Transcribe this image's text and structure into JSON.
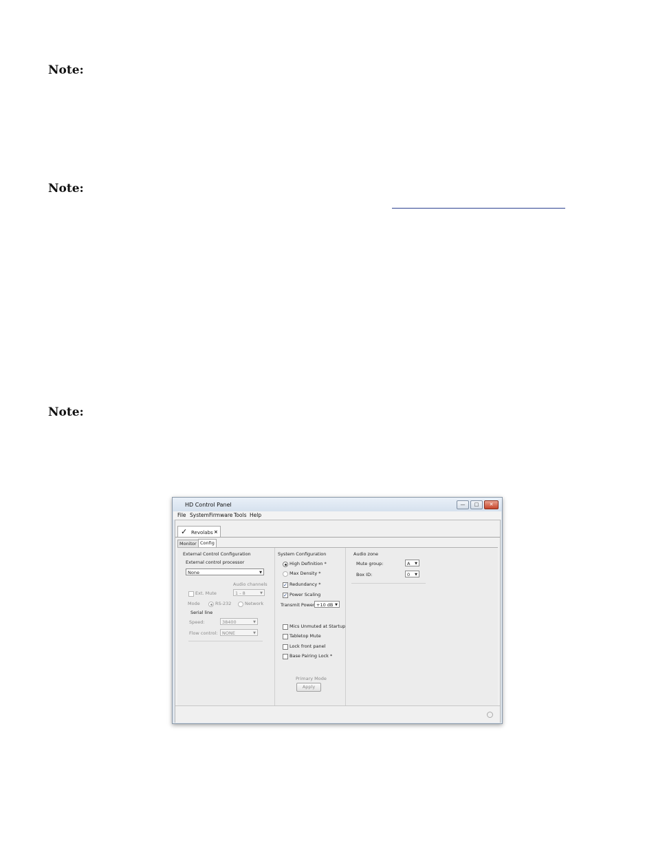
{
  "notes": {
    "label": "Note:"
  },
  "window": {
    "title": "HD Control Panel",
    "controls": {
      "minimize": "—",
      "maximize": "□",
      "close": "✕"
    },
    "menu": [
      "File",
      "System",
      "Firmware",
      "Tools",
      "Help"
    ],
    "doc_tab": {
      "label": "Revolabs",
      "close": "×"
    },
    "sub_tabs": [
      "Monitor",
      "Config"
    ],
    "external": {
      "heading": "External Control Configuration",
      "processor_label": "External control processor",
      "processor_value": "None",
      "audio_channels_label": "Audio channels",
      "ext_mute_label": "Ext. Mute",
      "audio_channels_value": "1 - 8",
      "mode_label": "Mode",
      "mode_rs232": "RS-232",
      "mode_network": "Network",
      "serial_line_label": "Serial line",
      "speed_label": "Speed:",
      "speed_value": "38400",
      "flow_label": "Flow control:",
      "flow_value": "NONE"
    },
    "system": {
      "heading": "System Configuration",
      "high_definition": "High Definition *",
      "max_density": "Max Density *",
      "redundancy": "Redundancy *",
      "power_scaling": "Power Scaling",
      "transmit_power_label": "Transmit Power",
      "transmit_power_value": "+10 dB",
      "mics_unmuted": "Mics Unmuted at Startup",
      "tabletop_mute": "Tabletop Mute",
      "lock_front_panel": "Lock front panel",
      "base_pairing_lock": "Base Pairing Lock *",
      "primary_mode_label": "Primary Mode",
      "apply_label": "Apply"
    },
    "audio_zone": {
      "heading": "Audio zone",
      "mute_group_label": "Mute group:",
      "mute_group_value": "A",
      "box_id_label": "Box ID:",
      "box_id_value": "0"
    }
  }
}
